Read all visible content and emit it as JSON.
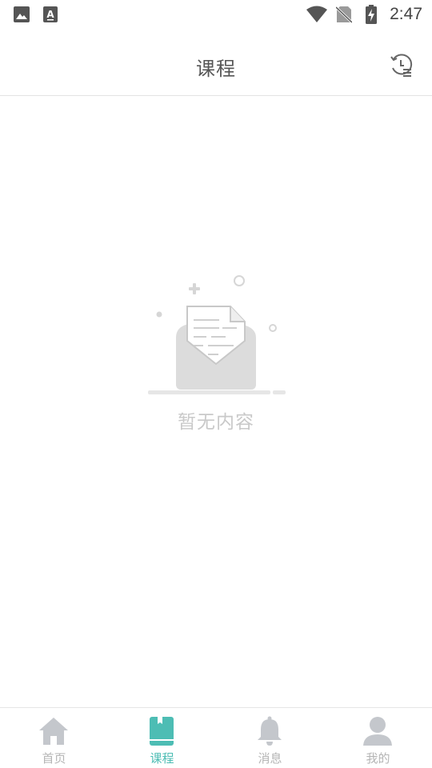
{
  "status_bar": {
    "time": "2:47",
    "left_icons": [
      "image-icon",
      "text-a-icon"
    ],
    "right_icons": [
      "wifi-icon",
      "no-sim-icon",
      "battery-charging-icon"
    ]
  },
  "header": {
    "title": "课程",
    "action_icon": "history-icon"
  },
  "empty_state": {
    "icon": "empty-mail-icon",
    "text": "暂无内容"
  },
  "bottom_nav": {
    "active_color": "#4dbdb4",
    "inactive_color": "#c4c7cc",
    "items": [
      {
        "label": "首页",
        "icon": "home-icon",
        "active": false
      },
      {
        "label": "课程",
        "icon": "book-icon",
        "active": true
      },
      {
        "label": "消息",
        "icon": "bell-icon",
        "active": false
      },
      {
        "label": "我的",
        "icon": "user-icon",
        "active": false
      }
    ]
  }
}
